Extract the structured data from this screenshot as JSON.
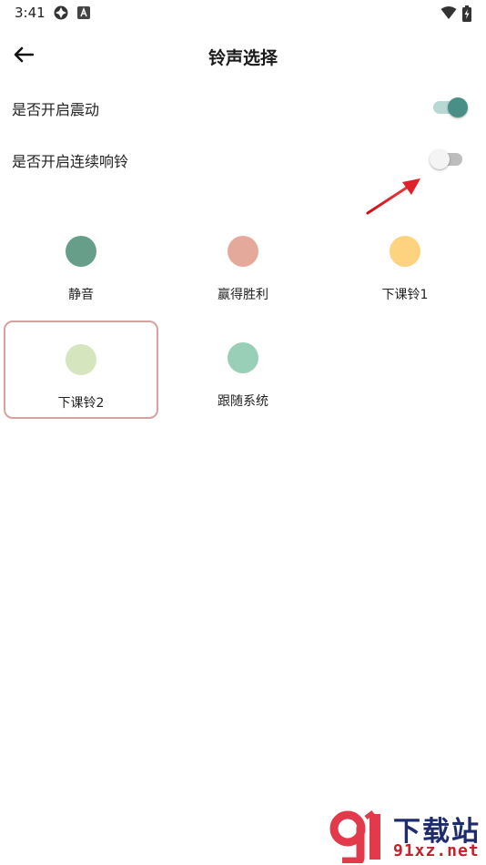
{
  "status_bar": {
    "time": "3:41",
    "icons": [
      "app-notification-icon",
      "a-letter-icon",
      "wifi-icon",
      "battery-charging-icon"
    ]
  },
  "app_bar": {
    "title": "铃声选择",
    "back_icon": "arrow-left-icon"
  },
  "settings": [
    {
      "label": "是否开启震动",
      "enabled": true
    },
    {
      "label": "是否开启连续响铃",
      "enabled": false
    }
  ],
  "ringtones": [
    {
      "label": "静音",
      "color": "#669e8a",
      "selected": false
    },
    {
      "label": "赢得胜利",
      "color": "#e4a99a",
      "selected": false
    },
    {
      "label": "下课铃1",
      "color": "#fdd37f",
      "selected": false
    },
    {
      "label": "下课铃2",
      "color": "#d5e6be",
      "selected": true
    },
    {
      "label": "跟随系统",
      "color": "#98cfb6",
      "selected": false
    }
  ],
  "colors": {
    "toggle_on_thumb": "#4a8f87",
    "toggle_on_track": "#b8d8d3",
    "selected_border": "#d6a1a1",
    "annotation_arrow": "#e0202a"
  },
  "watermark": {
    "title": "下载站",
    "site": "91xz.net"
  }
}
